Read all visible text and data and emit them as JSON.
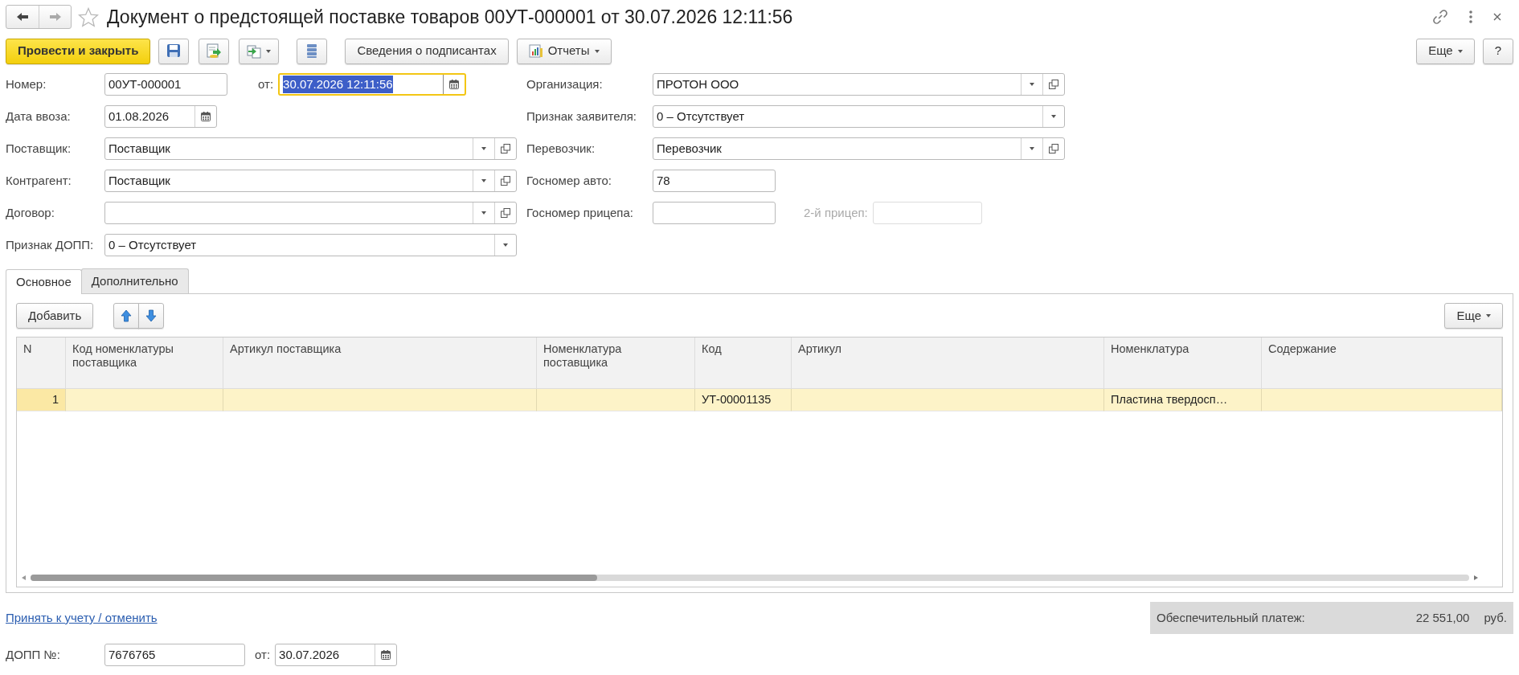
{
  "window": {
    "title": "Документ о предстоящей поставке товаров 00УТ-000001 от 30.07.2026 12:11:56"
  },
  "toolbar": {
    "buttons": [
      {
        "kind": "primary",
        "label": "Провести и закрыть"
      },
      {
        "kind": "save"
      },
      {
        "kind": "post"
      },
      {
        "kind": "create-based",
        "dropdown": true
      },
      {
        "kind": "structure"
      },
      {
        "kind": "text",
        "label": "Сведения о подписантах"
      },
      {
        "kind": "reports",
        "label": "Отчеты",
        "dropdown": true
      }
    ],
    "right": [
      {
        "label": "Еще",
        "dropdown": true
      },
      {
        "label": "?"
      }
    ]
  },
  "form": {
    "left": [
      {
        "label": "Номер:",
        "kind": "text",
        "value": "00УТ-000001",
        "extra": {
          "label": "от:",
          "kind": "datetime",
          "value": "30.07.2026 12:11:56",
          "focused": true
        }
      },
      {
        "label": "Дата ввоза:",
        "kind": "date",
        "value": "01.08.2026"
      },
      {
        "label": "Поставщик:",
        "kind": "ref",
        "value": "Поставщик"
      },
      {
        "label": "Контрагент:",
        "kind": "ref",
        "value": "Поставщик"
      },
      {
        "label": "Договор:",
        "kind": "ref"
      },
      {
        "label": "Признак ДОПП:",
        "kind": "choice",
        "value": "0 – Отсутствует"
      }
    ],
    "right": [
      {
        "label": "Организация:",
        "kind": "ref",
        "value": "ПРОТОН ООО"
      },
      {
        "label": "Признак заявителя:",
        "kind": "choice",
        "value": "0 – Отсутствует"
      },
      {
        "label": "Перевозчик:",
        "kind": "ref",
        "value": "Перевозчик"
      },
      {
        "label": "Госномер авто:",
        "kind": "text",
        "value": "78"
      },
      {
        "label": "Госномер прицепа:",
        "kind": "text",
        "extra": {
          "label": "2-й прицеп:",
          "kind": "text",
          "disabled": true
        }
      }
    ]
  },
  "tabs": [
    {
      "label": "Основное",
      "selected": true
    },
    {
      "label": "Дополнительно",
      "selected": false
    }
  ],
  "table": {
    "add_button": "Добавить",
    "more_button": "Еще",
    "columns": [
      "N",
      "Код номенклатуры поставщика",
      "Артикул поставщика",
      "Номенклатура поставщика",
      "Код",
      "Артикул",
      "Номенклатура",
      "Содержание"
    ],
    "rows": [
      {
        "selected": true,
        "cells": [
          "1",
          null,
          null,
          null,
          "УТ-00001135",
          null,
          "Пластина твердосп…",
          null
        ]
      }
    ]
  },
  "footer": {
    "link": "Принять к учету / отменить",
    "payment": {
      "label": "Обеспечительный платеж:",
      "amount": "22 551,00",
      "currency": "руб."
    },
    "dopp": {
      "label": "ДОПП №:",
      "value": "7676765",
      "date_label": "от:",
      "date": "30.07.2026"
    }
  }
}
